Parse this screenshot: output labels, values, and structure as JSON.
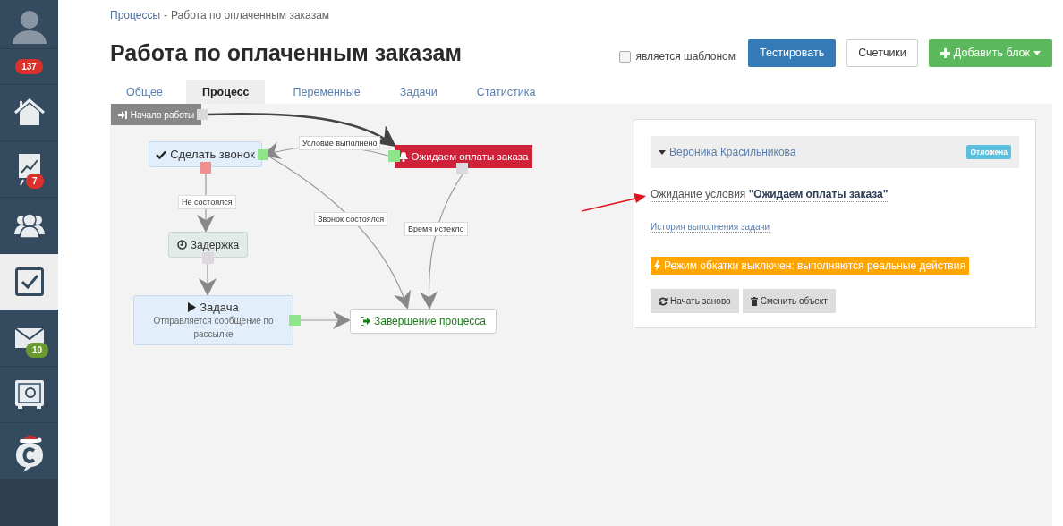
{
  "sidebar": {
    "profile": {
      "badge": "137",
      "color": "#d9312b"
    },
    "items": [
      {
        "selected": false
      },
      {
        "selected": false,
        "badge": "7",
        "color": "#d9312b"
      },
      {
        "selected": false
      },
      {
        "selected": true
      },
      {
        "selected": false,
        "badge": "10",
        "color": "#6a9b2e"
      },
      {
        "selected": false
      },
      {
        "selected": false
      }
    ]
  },
  "breadcrumb": {
    "link": "Процессы",
    "separator": "-",
    "current": "Работа по оплаченным заказам"
  },
  "title": "Работа по оплаченным заказам",
  "template_checkbox": {
    "label": "является шаблоном",
    "checked": false
  },
  "buttons": [
    {
      "kind": "primary",
      "label": "Тестировать"
    },
    {
      "kind": "default",
      "label": "Счетчики"
    },
    {
      "kind": "success",
      "label": "Добавить блок"
    }
  ],
  "tabs": [
    {
      "label": "Общее",
      "selected": false
    },
    {
      "label": "Процесс",
      "selected": true
    },
    {
      "label": "Переменные",
      "selected": false
    },
    {
      "label": "Задачи",
      "selected": false
    },
    {
      "label": "Статистика",
      "selected": false
    }
  ],
  "diagram": {
    "nodes": [
      {
        "kind": "start",
        "label": "Начало работы"
      },
      {
        "kind": "action",
        "label": "Сделать звонок"
      },
      {
        "kind": "wait",
        "label": "Ожидаем оплаты заказа"
      },
      {
        "kind": "delay",
        "label": "Задержка"
      },
      {
        "kind": "task",
        "label": "Задача",
        "description": "Отправляется сообщение по рассылке"
      },
      {
        "kind": "finish",
        "label": "Завершение процесса"
      }
    ],
    "edges": [
      {
        "kind": "main"
      },
      {
        "kind": "branch",
        "label": "Условие выполнено"
      },
      {
        "kind": "branch",
        "label": "Не состоялся"
      },
      {
        "kind": "branch",
        "label": "Звонок состоялся"
      },
      {
        "kind": "branch",
        "label": "Время истекло"
      },
      {
        "kind": "branch"
      },
      {
        "kind": "branch"
      }
    ]
  },
  "details": {
    "assignee": {
      "name": "Вероника Красильникова",
      "expanded": true,
      "status": "Отложена"
    },
    "condition": "Ожидание условия **\"Ожидаем оплаты заказа\"**",
    "history_link": "История выполнения задачи",
    "warning": "Режим обкатки выключен: выполняются реальные действия",
    "buttons": [
      {
        "kind": "restart",
        "label": "Начать заново"
      },
      {
        "kind": "delete",
        "label": "Сменить объект"
      }
    ]
  }
}
